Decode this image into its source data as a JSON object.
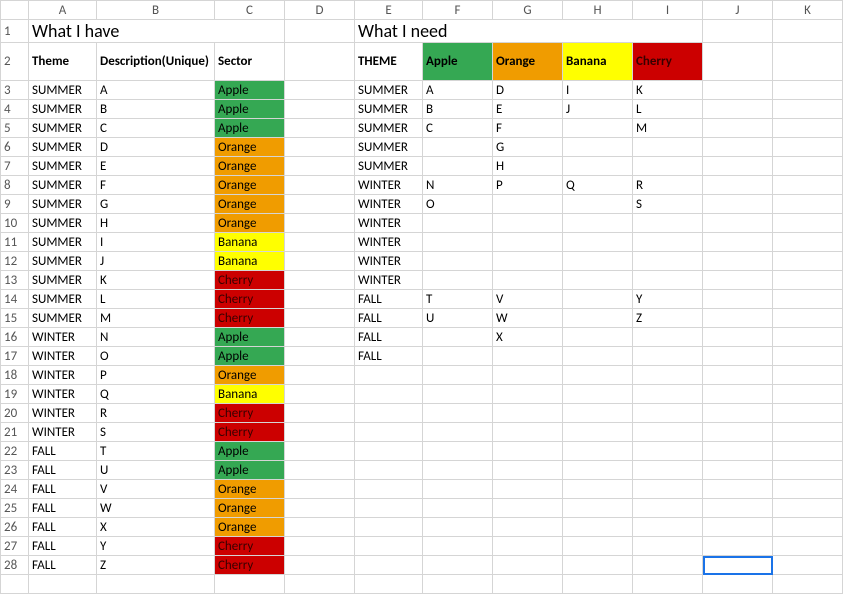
{
  "chart_data": {
    "type": "table",
    "tables": [
      {
        "title": "What I have",
        "columns": [
          "Theme",
          "Description(Unique)",
          "Sector"
        ],
        "rows": [
          [
            "SUMMER",
            "A",
            "Apple"
          ],
          [
            "SUMMER",
            "B",
            "Apple"
          ],
          [
            "SUMMER",
            "C",
            "Apple"
          ],
          [
            "SUMMER",
            "D",
            "Orange"
          ],
          [
            "SUMMER",
            "E",
            "Orange"
          ],
          [
            "SUMMER",
            "F",
            "Orange"
          ],
          [
            "SUMMER",
            "G",
            "Orange"
          ],
          [
            "SUMMER",
            "H",
            "Orange"
          ],
          [
            "SUMMER",
            "I",
            "Banana"
          ],
          [
            "SUMMER",
            "J",
            "Banana"
          ],
          [
            "SUMMER",
            "K",
            "Cherry"
          ],
          [
            "SUMMER",
            "L",
            "Cherry"
          ],
          [
            "SUMMER",
            "M",
            "Cherry"
          ],
          [
            "WINTER",
            "N",
            "Apple"
          ],
          [
            "WINTER",
            "O",
            "Apple"
          ],
          [
            "WINTER",
            "P",
            "Orange"
          ],
          [
            "WINTER",
            "Q",
            "Banana"
          ],
          [
            "WINTER",
            "R",
            "Cherry"
          ],
          [
            "WINTER",
            "S",
            "Cherry"
          ],
          [
            "FALL",
            "T",
            "Apple"
          ],
          [
            "FALL",
            "U",
            "Apple"
          ],
          [
            "FALL",
            "V",
            "Orange"
          ],
          [
            "FALL",
            "W",
            "Orange"
          ],
          [
            "FALL",
            "X",
            "Orange"
          ],
          [
            "FALL",
            "Y",
            "Cherry"
          ],
          [
            "FALL",
            "Z",
            "Cherry"
          ]
        ]
      },
      {
        "title": "What I need",
        "columns": [
          "THEME",
          "Apple",
          "Orange",
          "Banana",
          "Cherry"
        ],
        "rows": [
          [
            "SUMMER",
            "A",
            "D",
            "I",
            "K"
          ],
          [
            "SUMMER",
            "B",
            "E",
            "J",
            "L"
          ],
          [
            "SUMMER",
            "C",
            "F",
            "",
            "M"
          ],
          [
            "SUMMER",
            "",
            "G",
            "",
            ""
          ],
          [
            "SUMMER",
            "",
            "H",
            "",
            ""
          ],
          [
            "WINTER",
            "N",
            "P",
            "Q",
            "R"
          ],
          [
            "WINTER",
            "O",
            "",
            "",
            "S"
          ],
          [
            "WINTER",
            "",
            "",
            "",
            ""
          ],
          [
            "WINTER",
            "",
            "",
            "",
            ""
          ],
          [
            "WINTER",
            "",
            "",
            "",
            ""
          ],
          [
            "WINTER",
            "",
            "",
            "",
            ""
          ],
          [
            "FALL",
            "T",
            "V",
            "",
            "Y"
          ],
          [
            "FALL",
            "U",
            "W",
            "",
            "Z"
          ],
          [
            "FALL",
            "",
            "X",
            "",
            ""
          ],
          [
            "FALL",
            "",
            "",
            "",
            ""
          ]
        ]
      }
    ]
  },
  "cols": [
    "A",
    "B",
    "C",
    "D",
    "E",
    "F",
    "G",
    "H",
    "I",
    "J",
    "K"
  ],
  "title_have": "What I have",
  "title_need": "What I need",
  "have_hdr": {
    "theme": "Theme",
    "desc": "Description(Unique)",
    "sector": "Sector"
  },
  "need_hdr": {
    "theme": "THEME",
    "apple": "Apple",
    "orange": "Orange",
    "banana": "Banana",
    "cherry": "Cherry"
  },
  "rows": {
    "3": {
      "h": [
        "SUMMER",
        "A",
        "Apple",
        "green"
      ],
      "n": [
        "SUMMER",
        "A",
        "D",
        "I",
        "K"
      ]
    },
    "4": {
      "h": [
        "SUMMER",
        "B",
        "Apple",
        "green"
      ],
      "n": [
        "SUMMER",
        "B",
        "E",
        "J",
        "L"
      ]
    },
    "5": {
      "h": [
        "SUMMER",
        "C",
        "Apple",
        "green"
      ],
      "n": [
        "SUMMER",
        "C",
        "F",
        "",
        "M"
      ]
    },
    "6": {
      "h": [
        "SUMMER",
        "D",
        "Orange",
        "orange"
      ],
      "n": [
        "SUMMER",
        "",
        "G",
        "",
        ""
      ]
    },
    "7": {
      "h": [
        "SUMMER",
        "E",
        "Orange",
        "orange"
      ],
      "n": [
        "SUMMER",
        "",
        "H",
        "",
        ""
      ],
      "sep": true
    },
    "8": {
      "h": [
        "SUMMER",
        "F",
        "Orange",
        "orange"
      ],
      "n": [
        "WINTER",
        "N",
        "P",
        "Q",
        "R"
      ]
    },
    "9": {
      "h": [
        "SUMMER",
        "G",
        "Orange",
        "orange"
      ],
      "n": [
        "WINTER",
        "O",
        "",
        "",
        "S"
      ]
    },
    "10": {
      "h": [
        "SUMMER",
        "H",
        "Orange",
        "orange"
      ],
      "n": [
        "WINTER",
        "",
        "",
        "",
        ""
      ]
    },
    "11": {
      "h": [
        "SUMMER",
        "I",
        "Banana",
        "yellow"
      ],
      "n": [
        "WINTER",
        "",
        "",
        "",
        ""
      ]
    },
    "12": {
      "h": [
        "SUMMER",
        "J",
        "Banana",
        "yellow"
      ],
      "n": [
        "WINTER",
        "",
        "",
        "",
        ""
      ]
    },
    "13": {
      "h": [
        "SUMMER",
        "K",
        "Cherry",
        "red"
      ],
      "n": [
        "WINTER",
        "",
        "",
        "",
        ""
      ],
      "sep": true
    },
    "14": {
      "h": [
        "SUMMER",
        "L",
        "Cherry",
        "red"
      ],
      "n": [
        "FALL",
        "T",
        "V",
        "",
        "Y"
      ]
    },
    "15": {
      "h": [
        "SUMMER",
        "M",
        "Cherry",
        "red"
      ],
      "n": [
        "FALL",
        "U",
        "W",
        "",
        "Z"
      ]
    },
    "16": {
      "h": [
        "WINTER",
        "N",
        "Apple",
        "green"
      ],
      "n": [
        "FALL",
        "",
        "X",
        "",
        ""
      ]
    },
    "17": {
      "h": [
        "WINTER",
        "O",
        "Apple",
        "green"
      ],
      "n": [
        "FALL",
        "",
        "",
        "",
        ""
      ],
      "last": true
    },
    "18": {
      "h": [
        "WINTER",
        "P",
        "Orange",
        "orange"
      ]
    },
    "19": {
      "h": [
        "WINTER",
        "Q",
        "Banana",
        "yellow"
      ]
    },
    "20": {
      "h": [
        "WINTER",
        "R",
        "Cherry",
        "red"
      ]
    },
    "21": {
      "h": [
        "WINTER",
        "S",
        "Cherry",
        "red"
      ]
    },
    "22": {
      "h": [
        "FALL",
        "T",
        "Apple",
        "green"
      ]
    },
    "23": {
      "h": [
        "FALL",
        "U",
        "Apple",
        "green"
      ]
    },
    "24": {
      "h": [
        "FALL",
        "V",
        "Orange",
        "orange"
      ]
    },
    "25": {
      "h": [
        "FALL",
        "W",
        "Orange",
        "orange"
      ]
    },
    "26": {
      "h": [
        "FALL",
        "X",
        "Orange",
        "orange"
      ]
    },
    "27": {
      "h": [
        "FALL",
        "Y",
        "Cherry",
        "red"
      ]
    },
    "28": {
      "h": [
        "FALL",
        "Z",
        "Cherry",
        "red"
      ]
    }
  }
}
